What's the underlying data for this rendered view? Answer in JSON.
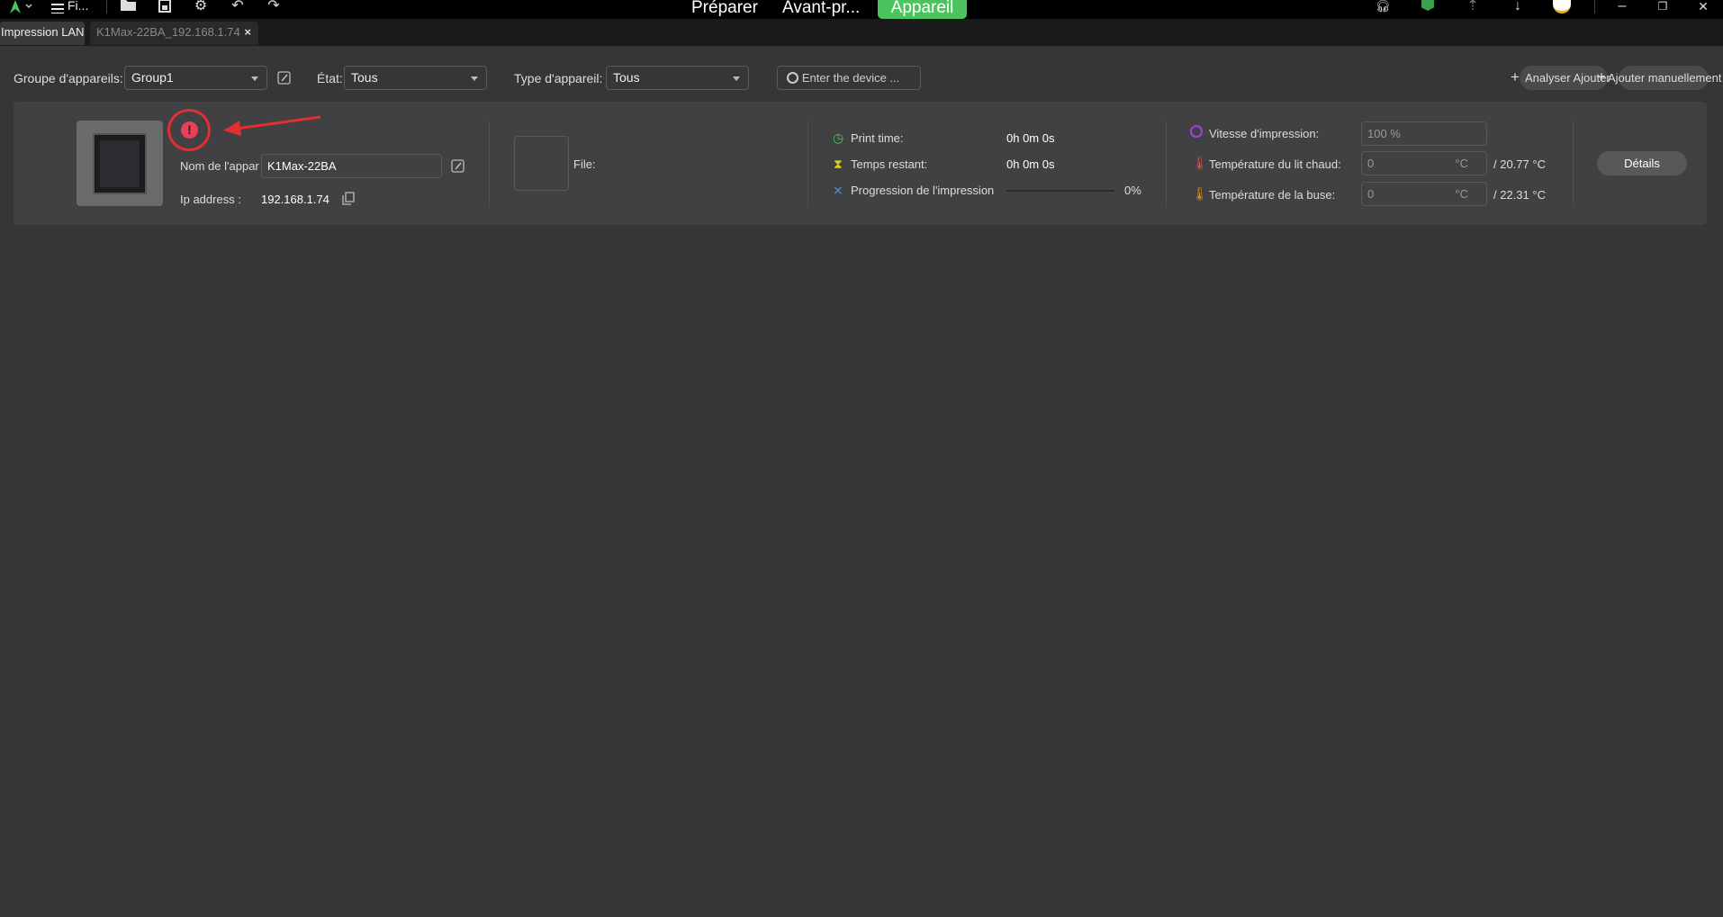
{
  "topbar": {
    "menu_label": "Fi...",
    "tabs": [
      {
        "label": "Préparer"
      },
      {
        "label": "Avant-pr..."
      },
      {
        "label": "Appareil"
      }
    ],
    "active_color": "#4cc45e",
    "icons": [
      "logo-icon",
      "open-folder-icon",
      "save-icon",
      "gear-icon",
      "undo-icon",
      "redo-icon",
      "headset-icon",
      "cube-icon",
      "cloud-upload-icon",
      "download-icon",
      "avatar-icon",
      "minimize-icon",
      "restore-icon",
      "close-icon"
    ]
  },
  "tabs": [
    {
      "label": "Impression LAN",
      "active": true
    },
    {
      "label": "K1Max-22BA_192.168.1.74",
      "closable": true
    }
  ],
  "toolbar": {
    "group_label": "Groupe d'appareils:",
    "group_value": "Group1",
    "state_label": "État:",
    "state_value": "Tous",
    "type_label": "Type d'appareil:",
    "type_value": "Tous",
    "search_placeholder": "Enter the device ...",
    "scan_label": "Analyser Ajouter",
    "add_manual_label": "Ajouter manuellement"
  },
  "device": {
    "status": "error",
    "name_label": "Nom de l'appar",
    "name_value": "K1Max-22BA",
    "ip_label": "Ip address :",
    "ip_value": "192.168.1.74",
    "file_label": "File:",
    "print_time_label": "Print time:",
    "print_time_value": "0h 0m 0s",
    "remaining_label": "Temps restant:",
    "remaining_value": "0h 0m 0s",
    "progress_label": "Progression de l'impression",
    "progress_value": "0%",
    "progress": 0,
    "speed_label": "Vitesse d'impression:",
    "speed_value": "100 %",
    "bed_label": "Température du lit chaud:",
    "bed_input": "0",
    "unit": "°C",
    "bed_current": "/ 20.77 °C",
    "nozzle_label": "Température de la buse:",
    "nozzle_input": "0",
    "nozzle_current": "/ 22.31 °C",
    "details_label": "Détails"
  },
  "annotation_color": "#e03030"
}
